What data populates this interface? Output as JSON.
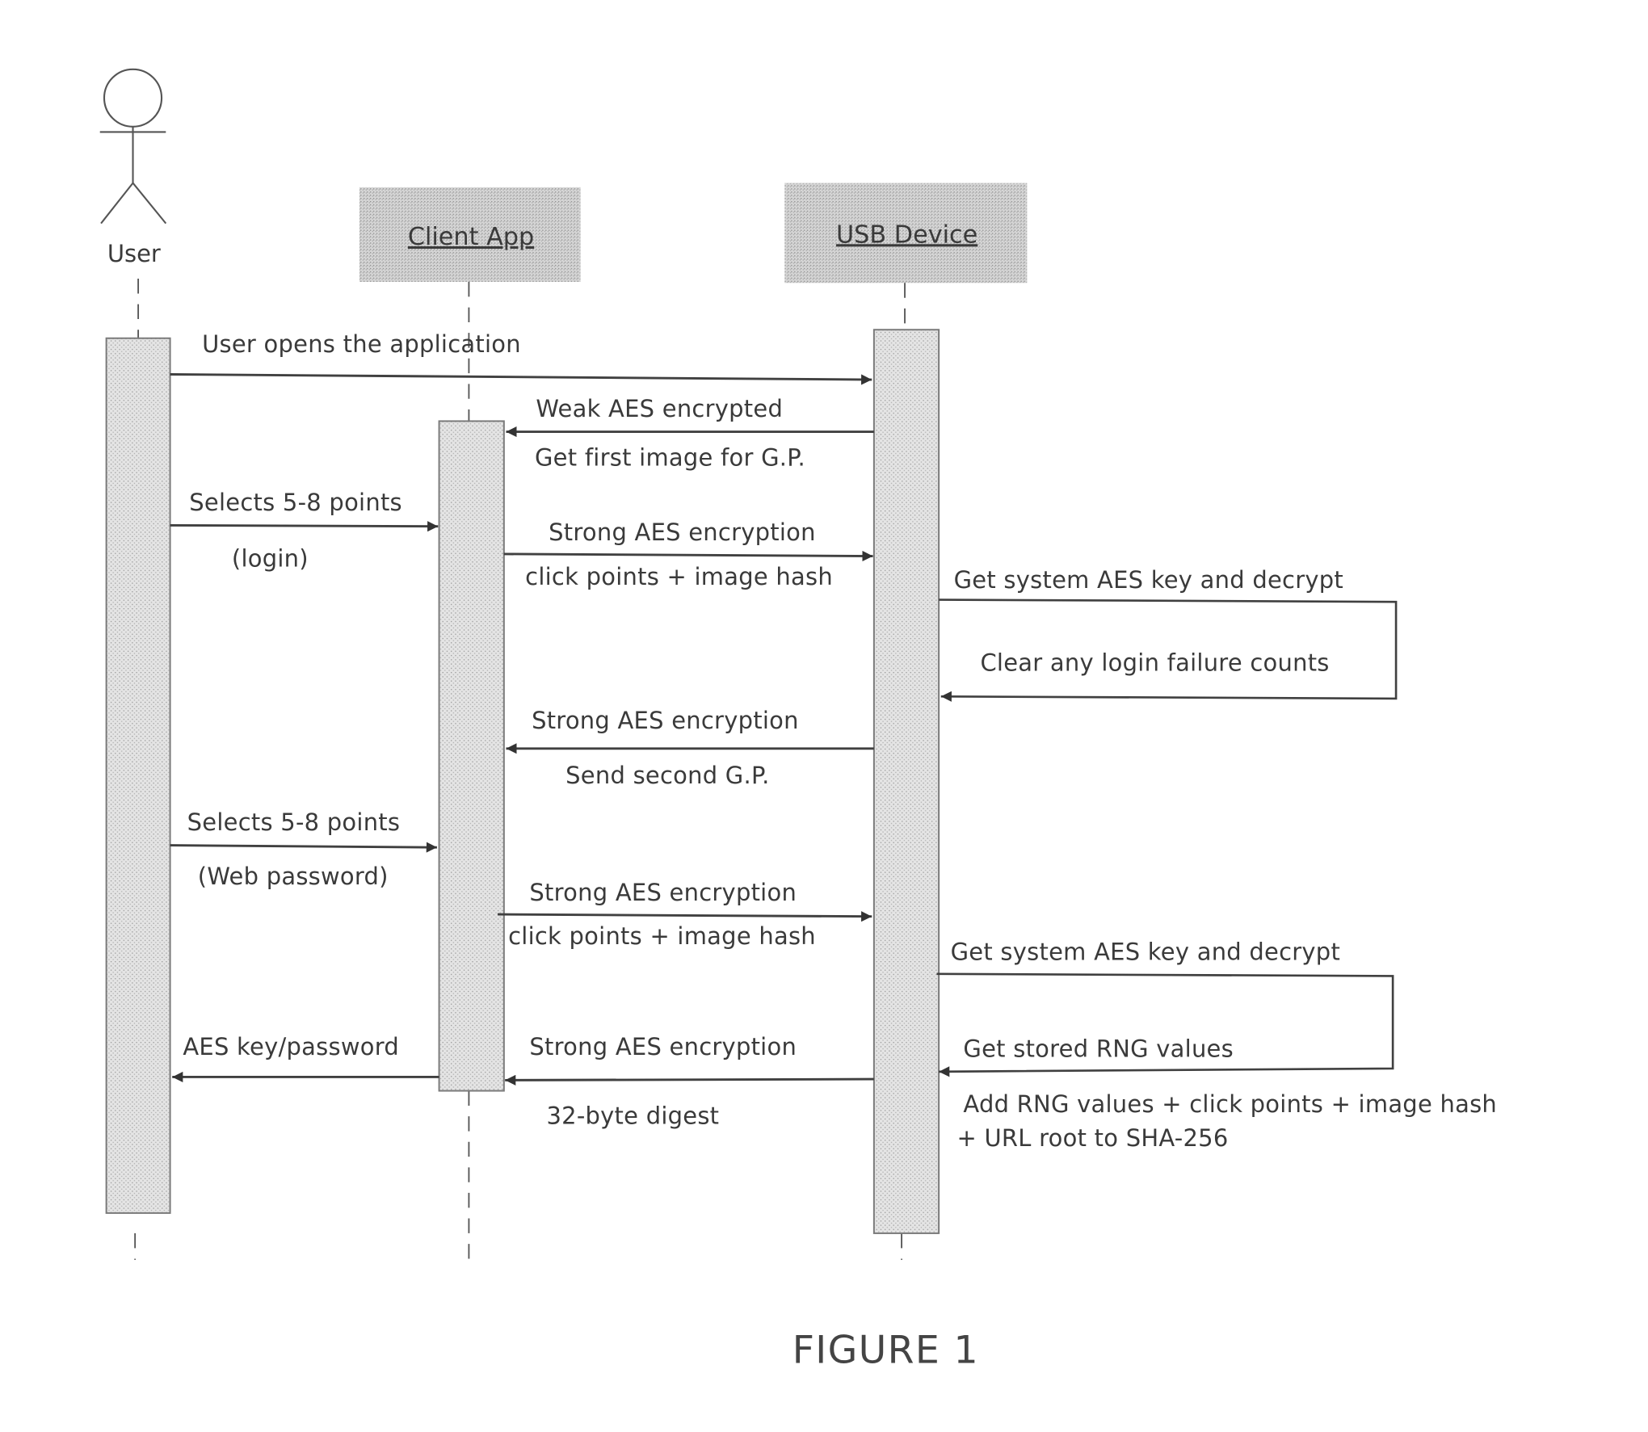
{
  "figure": {
    "caption": "FIGURE 1",
    "type": "UML sequence diagram"
  },
  "participants": [
    {
      "id": "user",
      "label": "User",
      "kind": "actor"
    },
    {
      "id": "client",
      "label": "Client App",
      "kind": "object"
    },
    {
      "id": "usb",
      "label": "USB Device",
      "kind": "object"
    }
  ],
  "messages": [
    {
      "id": "m1",
      "from": "user",
      "to": "usb",
      "direction": "right",
      "label_above": "User opens the application",
      "label_below": ""
    },
    {
      "id": "m2",
      "from": "usb",
      "to": "client",
      "direction": "left",
      "label_above": "Weak AES encrypted",
      "label_below": "Get first image for G.P."
    },
    {
      "id": "m3",
      "from": "user",
      "to": "client",
      "direction": "right",
      "label_above": "Selects 5-8 points",
      "label_below": "(login)"
    },
    {
      "id": "m4",
      "from": "client",
      "to": "usb",
      "direction": "right",
      "label_above": "Strong AES encryption",
      "label_below": "click points + image hash"
    },
    {
      "id": "m5",
      "from": "usb",
      "to": "usb",
      "direction": "self",
      "label_above": "Get system AES key and decrypt",
      "label_below": "Clear any login failure counts"
    },
    {
      "id": "m6",
      "from": "usb",
      "to": "client",
      "direction": "left",
      "label_above": "Strong AES encryption",
      "label_below": "Send second G.P."
    },
    {
      "id": "m7",
      "from": "user",
      "to": "client",
      "direction": "right",
      "label_above": "Selects 5-8 points",
      "label_below": "(Web password)"
    },
    {
      "id": "m8",
      "from": "client",
      "to": "usb",
      "direction": "right",
      "label_above": "Strong AES encryption",
      "label_below": "click points + image hash"
    },
    {
      "id": "m9",
      "from": "usb",
      "to": "usb",
      "direction": "self",
      "label_above": "Get system AES key and decrypt",
      "label_below": "Get stored RNG values"
    },
    {
      "id": "m10",
      "from": "usb",
      "to": "client",
      "direction": "left",
      "label_above": "Strong AES encryption",
      "label_below": "32-byte digest"
    },
    {
      "id": "m11",
      "from": "client",
      "to": "user",
      "direction": "left",
      "label_above": "AES key/password",
      "label_below": ""
    }
  ],
  "notes": [
    {
      "id": "n1",
      "attached_to": "usb",
      "lines": [
        "Add RNG values + click points + image hash",
        "+ URL root to SHA-256"
      ]
    }
  ]
}
